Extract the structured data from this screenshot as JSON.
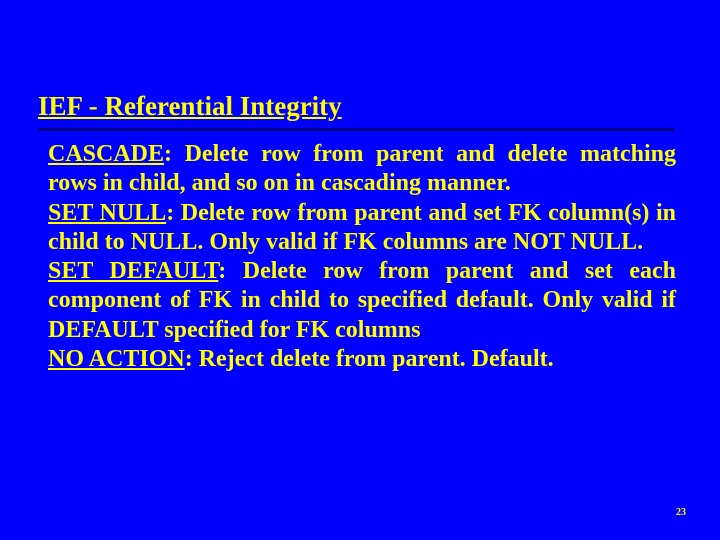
{
  "slide": {
    "title": "IEF - Referential Integrity",
    "cascade_term": "CASCADE",
    "cascade_text": ": Delete row from parent and delete matching rows in child, and so on in cascading manner.",
    "setnull_term": "SET NULL",
    "setnull_text": ": Delete row from parent and set FK column(s) in child to NULL. Only valid if FK columns are NOT NULL.",
    "setdefault_term": "SET DEFAULT",
    "setdefault_text": ": Delete row from parent and set each component of FK in child to specified default. Only valid if DEFAULT specified for FK columns",
    "noaction_term": "NO ACTION",
    "noaction_text": ": Reject delete from parent. Default.",
    "page_number": "23"
  }
}
